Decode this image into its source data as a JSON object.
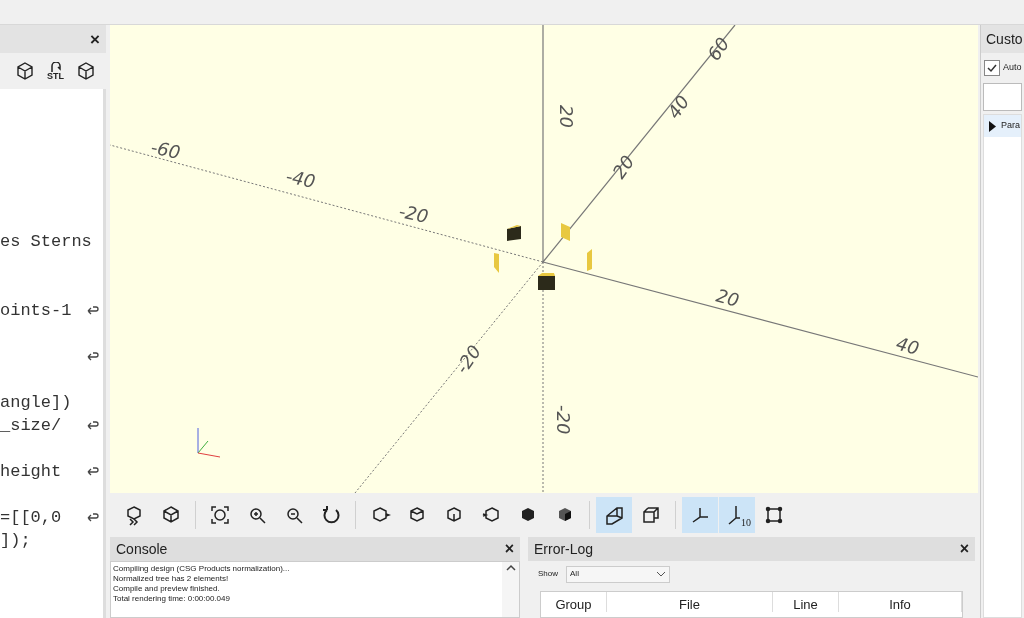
{
  "editor": {
    "toolbar": [
      {
        "kind": "render"
      },
      {
        "kind": "stl",
        "label": "STL"
      },
      {
        "kind": "print"
      }
    ],
    "lines": [
      {
        "wrap": false
      },
      {
        "wrap": false
      },
      {
        "wrap": false
      },
      {
        "wrap": false
      },
      {
        "wrap": false
      },
      {
        "wrap": false
      },
      {
        "text": "es Sterns",
        "wrap": false
      },
      {
        "wrap": false
      },
      {
        "wrap": false
      },
      {
        "text": "oints-1",
        "wrap": true
      },
      {
        "wrap": false
      },
      {
        "wrap": true
      },
      {
        "wrap": false
      },
      {
        "text": "angle])",
        "wrap": false
      },
      {
        "text": "_size/",
        "wrap": true
      },
      {
        "wrap": false
      },
      {
        "text": "height",
        "wrap": true
      },
      {
        "wrap": false
      },
      {
        "text": "=[[0,0",
        "wrap": true
      },
      {
        "text": "]);",
        "wrap": false
      }
    ]
  },
  "viewport": {
    "x_labels": [
      "-60",
      "-40",
      "-20",
      "20",
      "40"
    ],
    "z_labels": [
      "20",
      "-20"
    ],
    "y_labels": [
      "60",
      "40",
      "20",
      "-20"
    ]
  },
  "view_toolbar": [
    {
      "kind": "preview",
      "selected": false
    },
    {
      "kind": "render",
      "selected": false
    },
    {
      "kind": "sep"
    },
    {
      "kind": "zoom-all",
      "selected": false
    },
    {
      "kind": "zoom-in",
      "selected": false
    },
    {
      "kind": "zoom-out",
      "selected": false
    },
    {
      "kind": "reset",
      "selected": false
    },
    {
      "kind": "sep"
    },
    {
      "kind": "right",
      "selected": false
    },
    {
      "kind": "top",
      "selected": false
    },
    {
      "kind": "bottom",
      "selected": false
    },
    {
      "kind": "left",
      "selected": false
    },
    {
      "kind": "front",
      "selected": false
    },
    {
      "kind": "back",
      "selected": false
    },
    {
      "kind": "sep"
    },
    {
      "kind": "perspective",
      "selected": true
    },
    {
      "kind": "orthogonal",
      "selected": false
    },
    {
      "kind": "sep"
    },
    {
      "kind": "axes",
      "selected": true
    },
    {
      "kind": "scale",
      "selected": true,
      "label": "10"
    },
    {
      "kind": "edges",
      "selected": false
    }
  ],
  "console": {
    "title": "Console",
    "close": "×",
    "lines": [
      "Compiling design (CSG Products normalization)...",
      "Normalized tree has 2 elements!",
      "Compile and preview finished.",
      "Total rendering time: 0:00:00.049"
    ]
  },
  "error_log": {
    "title": "Error-Log",
    "close": "×",
    "show_label": "Show",
    "show_value": "All",
    "columns": [
      "Group",
      "File",
      "Line",
      "Info"
    ]
  },
  "left_panel": {
    "close": "×"
  },
  "customizer": {
    "title": "Custo",
    "auto_label": "Auto",
    "auto_checked": true,
    "tree_item": "Para",
    "tree_expanded": false
  }
}
